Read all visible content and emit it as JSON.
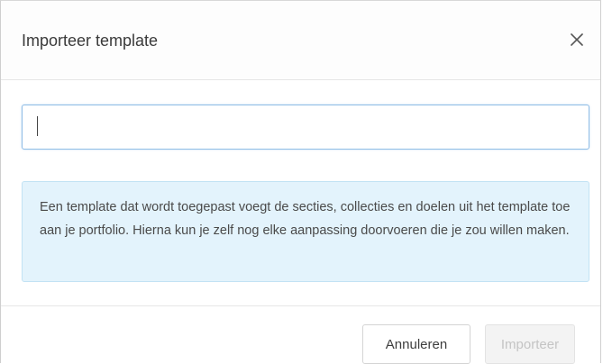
{
  "dialog": {
    "title": "Importeer template",
    "close_icon": "close-icon"
  },
  "input": {
    "value": "",
    "placeholder": ""
  },
  "info": {
    "text": "Een template dat wordt toegepast voegt de secties, collecties en doelen uit het template toe aan je portfolio. Hierna kun je zelf nog elke aanpassing doorvoeren die je zou willen maken."
  },
  "footer": {
    "cancel_label": "Annuleren",
    "import_label": "Importeer",
    "import_disabled": true
  },
  "colors": {
    "info_background": "#e3f3fc",
    "input_focus_border": "#8fbde6"
  }
}
